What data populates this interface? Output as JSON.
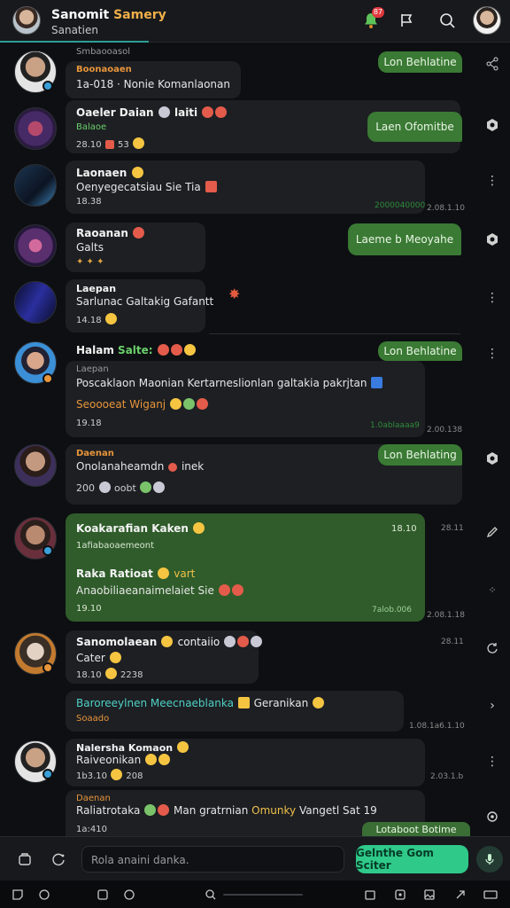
{
  "header": {
    "title_part1": "Sanomit",
    "title_part2": "Samery",
    "subtitle": "Sanatien",
    "notification_count": "87"
  },
  "messages": {
    "m1": {
      "top_label": "Smbaooasol",
      "name": "Boonaoaen",
      "body": "1a-018 ·  Nonie Komanlaonan",
      "out": "Lon Behlatine"
    },
    "m2": {
      "name": "Oaeler Daian",
      "name_suffix": "laiti",
      "sub": "Balaoe",
      "time": "28.10",
      "count": "53",
      "out": "Laen Ofomitbe"
    },
    "m3": {
      "name": "Laonaen",
      "body": "Oenyegecatsiau Sie Tia",
      "time": "18.38",
      "footer": "2000040000",
      "stamp": "2.08.1.10"
    },
    "m4": {
      "name": "Raoanan",
      "sub": "Galts",
      "out": "Laeme b Meoyahe"
    },
    "m5": {
      "name": "Laepan",
      "body": "Sarlunac Galtakig Gafantt",
      "time": "14.18"
    },
    "m6": {
      "name": "Halam",
      "name_accent": "Salte:",
      "out": "Lon Behlatine",
      "sub": "Laepan",
      "body": "Poscaklaon Maonian  Kertarneslionlan galtakia pakrjtan",
      "link": "Seoooeat Wiganj",
      "time": "19.18",
      "footer": "1.0ablaaaa9",
      "stamp": "2.00.138"
    },
    "m7": {
      "name": "Daenan",
      "body": "Onolanaheamdn",
      "body_accent": "inek",
      "time": "200",
      "extra": "oobt",
      "out": "Lon Behlating"
    },
    "m8": {
      "name": "Koakarafian Kaken",
      "time": "18.10",
      "sub": "1afiabaoaemeont",
      "name2": "Raka Ratioat",
      "name2_accent": "vart",
      "body": "Anaobiliaeanaimelaiet Sie",
      "time2": "19.10",
      "footer": "7alob.006",
      "stamp": "2.08.1.18",
      "stamp_top": "28.11"
    },
    "m9": {
      "name": "Sanomolaean",
      "name_suffix": "contaiio",
      "sub": "Cater",
      "time": "18.10",
      "count": "2238",
      "stamp": "28.11"
    },
    "m10": {
      "body": "Baroreeylnen Meecnaeblanka",
      "suffix": "Geranikan",
      "sub": "Soaado",
      "stamp": "1.08.1a6.1.10"
    },
    "m11": {
      "name": "Nalersha Komaon",
      "sub": "Raiveonikan",
      "time": "1b3.10",
      "count": "208",
      "stamp": "2.03.1.b"
    },
    "m12": {
      "name": "Daenan",
      "body": "Raliatrotaka",
      "body2": "Man  gratrnian",
      "body_accent": "Omunky",
      "body3": "Vangetl Sat 19",
      "time": "1a:410",
      "out": "Lotaboot  Botime"
    }
  },
  "composer": {
    "placeholder": "Rola anaini danka.",
    "send_label": "Gelnthe Gom Sciter"
  },
  "colors": {
    "accent_teal": "#2f9e95",
    "bubble_green": "#3a7a34",
    "send_green": "#2fc98a",
    "orange": "#e8953a"
  }
}
